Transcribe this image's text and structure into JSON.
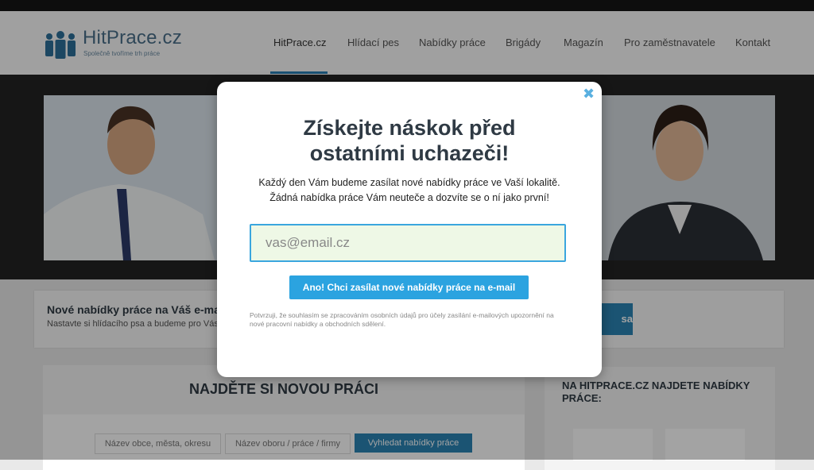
{
  "header": {
    "logo": {
      "name": "HitPrace.cz",
      "tagline": "Společně tvoříme trh práce"
    },
    "nav": [
      {
        "label": "HitPrace.cz",
        "active": true
      },
      {
        "label": "Hlídací pes"
      },
      {
        "label": "Nabídky práce"
      },
      {
        "label": "Brigády"
      },
      {
        "label": "Magazín"
      },
      {
        "label": "Pro zaměstnavatele"
      },
      {
        "label": "Kontakt"
      }
    ]
  },
  "subscribe": {
    "title": "Nové nabídky práce na Váš e-mail",
    "subtitle": "Nastavte si hlídacího psa a budeme pro Vás",
    "button": "sa"
  },
  "find": {
    "title": "NAJDĚTE SI NOVOU PRÁCI",
    "location_placeholder": "Název obce, města, okresu",
    "field_placeholder": "Název oboru / práce / firmy",
    "search_button": "Vyhledat nabídky práce"
  },
  "sidebar": {
    "title": "NA HITPRACE.CZ NAJDETE NABÍDKY PRÁCE:"
  },
  "modal": {
    "close_symbol": "✖",
    "title_line1": "Získejte náskok před",
    "title_line2": "ostatními uchazeči!",
    "text_line1": "Každý den Vám budeme zasílat nové nabídky práce ve Vaší lokalitě.",
    "text_line2": "Žádná nabídka práce Vám neuteče a dozvíte se o ní jako první!",
    "email_placeholder": "vas@email.cz",
    "cta": "Ano! Chci zasílat nové nabídky práce na e-mail",
    "disclaimer": "Potvrzuji, že souhlasím se zpracováním osobních údajů pro účely zasílání e-mailových upozornění na nové pracovní nabídky a obchodních sdělení."
  },
  "colors": {
    "accent": "#2ba3e0",
    "brand": "#2b84b5",
    "dark": "#2f3a44"
  },
  "icons": {
    "close": "close-icon",
    "logo": "people-group-icon"
  }
}
